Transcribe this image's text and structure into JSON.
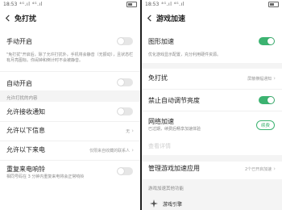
{
  "left": {
    "status": {
      "time": "18:53",
      "signal": "⁴ᴳ.ıl ⁴ᴳ.ıl",
      "battery": ""
    },
    "header": {
      "title": "免打扰"
    },
    "manual": {
      "label": "手动开启",
      "desc": "\"免打扰\"开启后，除了允许打扰外，手机将会静音（无振动），且状态栏有月亮图标。你闹钟和倒计时不会被静音。"
    },
    "auto": {
      "label": "自动开启"
    },
    "section_title": "允许打扰的内容",
    "allow_notify": {
      "label": "允许接收通知"
    },
    "allow_messages": {
      "label": "允许以下信息",
      "value": "无"
    },
    "allow_calls": {
      "label": "允许以下来电",
      "value": "仅限来自收藏的联系人"
    },
    "repeat_calls": {
      "label": "重复来电响铃",
      "desc": "相同号码在 3 分钟内重复来电将会正常响铃"
    }
  },
  "right": {
    "status": {
      "time": "18:53",
      "signal": "⁴ᴳ.ıl ⁴ᴳ.ıl",
      "battery": ""
    },
    "header": {
      "title": "游戏加速"
    },
    "graphics": {
      "label": "图形加速",
      "desc": "优化游戏显示配置，充分利用硬件资源。"
    },
    "dnd": {
      "label": "免打扰",
      "value": "屏蔽横幅通知"
    },
    "brightness": {
      "label": "禁止自动调节亮度"
    },
    "network": {
      "label": "网络加速",
      "desc": "已过期，续费后畅享加速体验",
      "badge": "续费"
    },
    "details": {
      "label": "查看详情"
    },
    "manage": {
      "label": "管理游戏加速应用",
      "value": "2个已开启加速"
    },
    "section_title": "游戏加速其他功能",
    "engine": {
      "label": "游戏引擎"
    }
  },
  "colors": {
    "accent": "#3cb371"
  }
}
